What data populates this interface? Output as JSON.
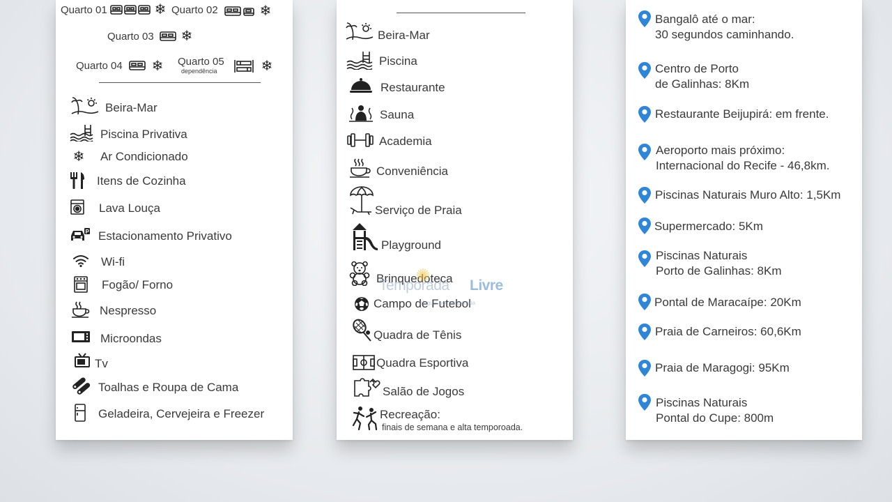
{
  "card1": {
    "rooms": {
      "q1": "Quarto 01",
      "q2": "Quarto 02",
      "q3": "Quarto 03",
      "q4": "Quarto 04",
      "q5": "Quarto 05",
      "q5_sub": "dependência"
    },
    "amenities": [
      {
        "label": "Beira-Mar",
        "icon": "beach-icon"
      },
      {
        "label": "Piscina Privativa",
        "icon": "pool-icon"
      },
      {
        "label": "Ar Condicionado",
        "icon": "snowflake-icon"
      },
      {
        "label": "Itens de Cozinha",
        "icon": "cutlery-icon"
      },
      {
        "label": "Lava Louça",
        "icon": "dishwasher-icon"
      },
      {
        "label": "Estacionamento Privativo",
        "icon": "parking-icon"
      },
      {
        "label": "Wi-fi",
        "icon": "wifi-icon"
      },
      {
        "label": "Fogão/ Forno",
        "icon": "stove-icon"
      },
      {
        "label": "Nespresso",
        "icon": "coffee-icon"
      },
      {
        "label": "Microondas",
        "icon": "microwave-icon"
      },
      {
        "label": "Tv",
        "icon": "tv-icon"
      },
      {
        "label": "Toalhas e Roupa de Cama",
        "icon": "towels-icon"
      },
      {
        "label": "Geladeira, Cervejeira e Freezer",
        "icon": "fridge-icon"
      }
    ]
  },
  "card2": {
    "amenities": [
      {
        "label": "Beira-Mar",
        "icon": "beach-icon"
      },
      {
        "label": "Piscina",
        "icon": "pool-icon"
      },
      {
        "label": "Restaurante",
        "icon": "cloche-icon"
      },
      {
        "label": "Sauna",
        "icon": "sauna-icon"
      },
      {
        "label": "Academia",
        "icon": "dumbbell-icon"
      },
      {
        "label": "Conveniência",
        "icon": "cup-icon"
      },
      {
        "label": "Serviço de Praia",
        "icon": "umbrella-icon"
      },
      {
        "label": "Playground",
        "icon": "playground-icon"
      },
      {
        "label": "Brinquedoteca",
        "icon": "teddy-bear-icon"
      },
      {
        "label": "Campo de Futebol",
        "icon": "soccer-ball-icon"
      },
      {
        "label": "Quadra de Tênis",
        "icon": "tennis-icon"
      },
      {
        "label": "Quadra Esportiva",
        "icon": "court-icon"
      },
      {
        "label": "Salão de Jogos",
        "icon": "puzzle-icon"
      },
      {
        "label": "Recreação:",
        "icon": "kids-icon"
      }
    ],
    "recreation_note": "finais de semana e alta temporoada."
  },
  "card3": {
    "locations": [
      {
        "line1": "Bangalô até o mar:",
        "line2": "30 segundos caminhando."
      },
      {
        "line1": "Centro de Porto",
        "line2": "de Galinhas: 8Km"
      },
      {
        "line1": "Restaurante Beijupirá: em frente.",
        "line2": ""
      },
      {
        "line1": "Aeroporto mais próximo:",
        "line2": "Internacional do Recife - 46,8km."
      },
      {
        "line1": "Piscinas Naturais Muro Alto: 1,5Km",
        "line2": ""
      },
      {
        "line1": "Supermercado: 5Km",
        "line2": ""
      },
      {
        "line1": "Piscinas Naturais",
        "line2": "Porto de Galinhas: 8Km"
      },
      {
        "line1": "Pontal de Maracaípe: 20Km",
        "line2": ""
      },
      {
        "line1": "Praia de Carneiros: 60,6Km",
        "line2": ""
      },
      {
        "line1": "Praia de Maragogi: 95Km",
        "line2": ""
      },
      {
        "line1": "Piscinas Naturais",
        "line2": "Pontal do Cupe: 800m"
      }
    ],
    "pin_color": "#2f86d6"
  },
  "watermark": {
    "part1": "Temporada",
    "part2": "Livre",
    "tagline": "aluguel por temporada"
  }
}
